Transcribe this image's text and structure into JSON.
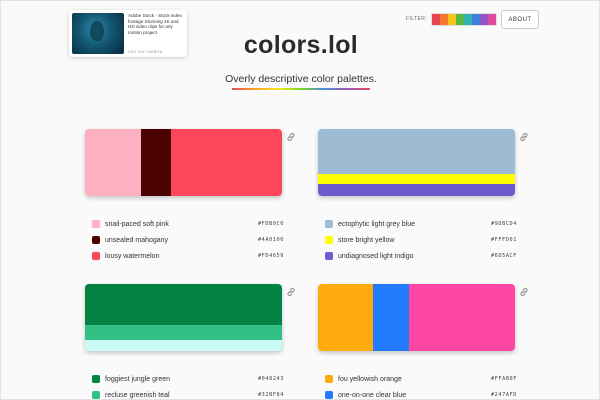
{
  "ad": {
    "text": "Adobe Stock - Stock video footage.Stunning 4K and HD video clips for any motion project",
    "via": "ADS VIA CARBON"
  },
  "filter": {
    "label": "FILTER:",
    "colors": [
      "#e8434f",
      "#f47a33",
      "#f5c518",
      "#59b947",
      "#2fb3b0",
      "#3d7fd9",
      "#8e56c7",
      "#e0479e"
    ]
  },
  "about_label": "ABOUT",
  "title": "colors.lol",
  "subtitle": "Overly descriptive color palettes.",
  "palettes": [
    {
      "layout": "vertical",
      "colors": [
        {
          "name": "snail-paced soft pink",
          "hex": "#FDB0C0"
        },
        {
          "name": "unsealed mahogany",
          "hex": "#4A0100"
        },
        {
          "name": "lousy watermelon",
          "hex": "#FD4659"
        }
      ]
    },
    {
      "layout": "horizontal",
      "colors": [
        {
          "name": "ectophytic light grey blue",
          "hex": "#9DBCD4"
        },
        {
          "name": "store bright yellow",
          "hex": "#FFFD01"
        },
        {
          "name": "undiagnosed light indigo",
          "hex": "#6D5ACF"
        }
      ]
    },
    {
      "layout": "horizontal",
      "colors": [
        {
          "name": "foggiest jungle green",
          "hex": "#048243"
        },
        {
          "name": "recluse greenish teal",
          "hex": "#32BF84"
        },
        {
          "name": "",
          "hex": "#C9FBF4"
        }
      ]
    },
    {
      "layout": "vertical",
      "colors": [
        {
          "name": "fou yellowish orange",
          "hex": "#FFAB0F"
        },
        {
          "name": "one-on-one clear blue",
          "hex": "#247AFD"
        },
        {
          "name": "",
          "hex": "#FE46A5"
        }
      ]
    }
  ]
}
